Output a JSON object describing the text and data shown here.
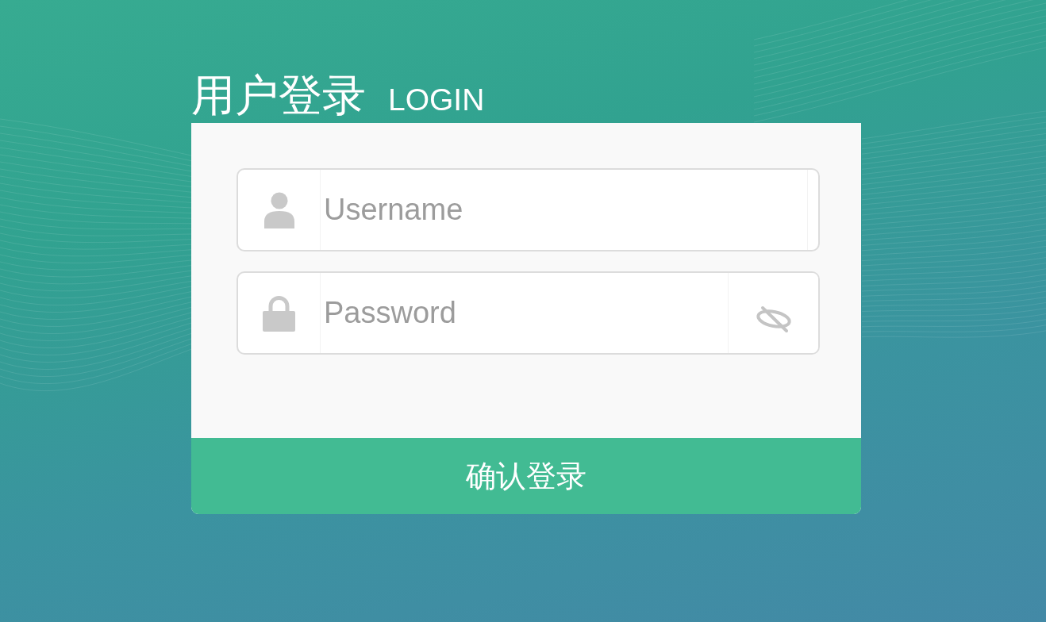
{
  "heading": {
    "title": "用户登录",
    "subtitle": "LOGIN"
  },
  "fields": [
    {
      "kind": "username",
      "placeholder": "Username"
    },
    {
      "kind": "password",
      "placeholder": "Password",
      "revealed": false
    }
  ],
  "submit_button": {
    "label": "确认登录"
  }
}
